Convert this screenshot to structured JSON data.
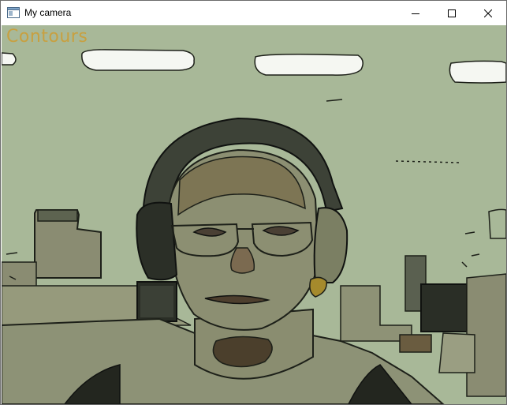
{
  "window": {
    "title": "My camera",
    "controls": {
      "minimize": "minimize-icon",
      "maximize": "maximize-icon",
      "close": "close-icon"
    }
  },
  "canvas": {
    "overlay_label": "Contours",
    "label_color": "#c8a040",
    "background_color": "#a8b898"
  }
}
